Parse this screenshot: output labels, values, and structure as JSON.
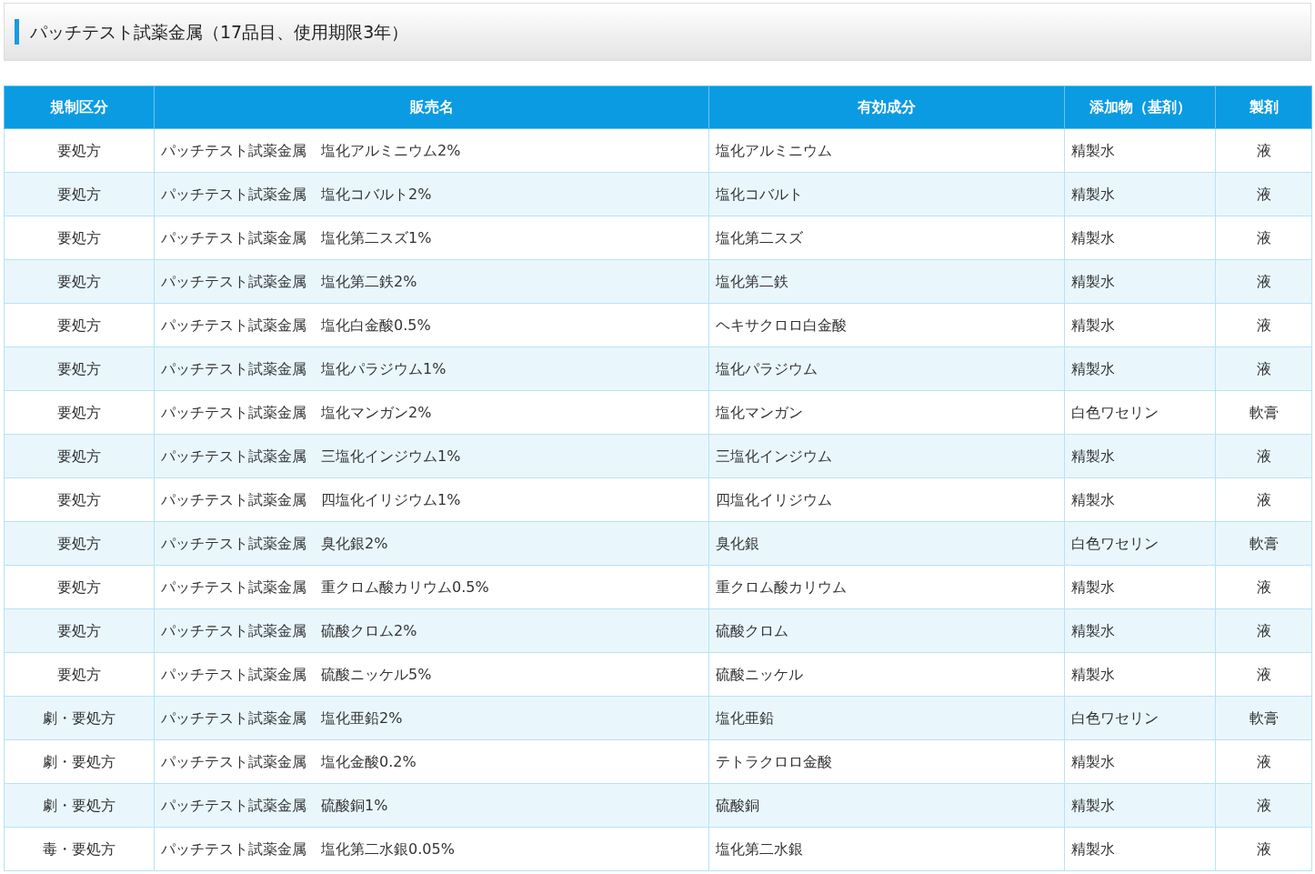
{
  "title": "パッチテスト試薬金属（17品目、使用期限3年）",
  "table": {
    "columns": [
      "規制区分",
      "販売名",
      "有効成分",
      "添加物（基剤）",
      "製剤"
    ],
    "rows": [
      [
        "要処方",
        "パッチテスト試薬金属　塩化アルミニウム2%",
        "塩化アルミニウム",
        "精製水",
        "液"
      ],
      [
        "要処方",
        "パッチテスト試薬金属　塩化コバルト2%",
        "塩化コバルト",
        "精製水",
        "液"
      ],
      [
        "要処方",
        "パッチテスト試薬金属　塩化第二スズ1%",
        "塩化第二スズ",
        "精製水",
        "液"
      ],
      [
        "要処方",
        "パッチテスト試薬金属　塩化第二鉄2%",
        "塩化第二鉄",
        "精製水",
        "液"
      ],
      [
        "要処方",
        "パッチテスト試薬金属　塩化白金酸0.5%",
        "ヘキサクロロ白金酸",
        "精製水",
        "液"
      ],
      [
        "要処方",
        "パッチテスト試薬金属　塩化パラジウム1%",
        "塩化パラジウム",
        "精製水",
        "液"
      ],
      [
        "要処方",
        "パッチテスト試薬金属　塩化マンガン2%",
        "塩化マンガン",
        "白色ワセリン",
        "軟膏"
      ],
      [
        "要処方",
        "パッチテスト試薬金属　三塩化インジウム1%",
        "三塩化インジウム",
        "精製水",
        "液"
      ],
      [
        "要処方",
        "パッチテスト試薬金属　四塩化イリジウム1%",
        "四塩化イリジウム",
        "精製水",
        "液"
      ],
      [
        "要処方",
        "パッチテスト試薬金属　臭化銀2%",
        "臭化銀",
        "白色ワセリン",
        "軟膏"
      ],
      [
        "要処方",
        "パッチテスト試薬金属　重クロム酸カリウム0.5%",
        "重クロム酸カリウム",
        "精製水",
        "液"
      ],
      [
        "要処方",
        "パッチテスト試薬金属　硫酸クロム2%",
        "硫酸クロム",
        "精製水",
        "液"
      ],
      [
        "要処方",
        "パッチテスト試薬金属　硫酸ニッケル5%",
        "硫酸ニッケル",
        "精製水",
        "液"
      ],
      [
        "劇・要処方",
        "パッチテスト試薬金属　塩化亜鉛2%",
        "塩化亜鉛",
        "白色ワセリン",
        "軟膏"
      ],
      [
        "劇・要処方",
        "パッチテスト試薬金属　塩化金酸0.2%",
        "テトラクロロ金酸",
        "精製水",
        "液"
      ],
      [
        "劇・要処方",
        "パッチテスト試薬金属　硫酸銅1%",
        "硫酸銅",
        "精製水",
        "液"
      ],
      [
        "毒・要処方",
        "パッチテスト試薬金属　塩化第二水銀0.05%",
        "塩化第二水銀",
        "精製水",
        "液"
      ]
    ]
  }
}
